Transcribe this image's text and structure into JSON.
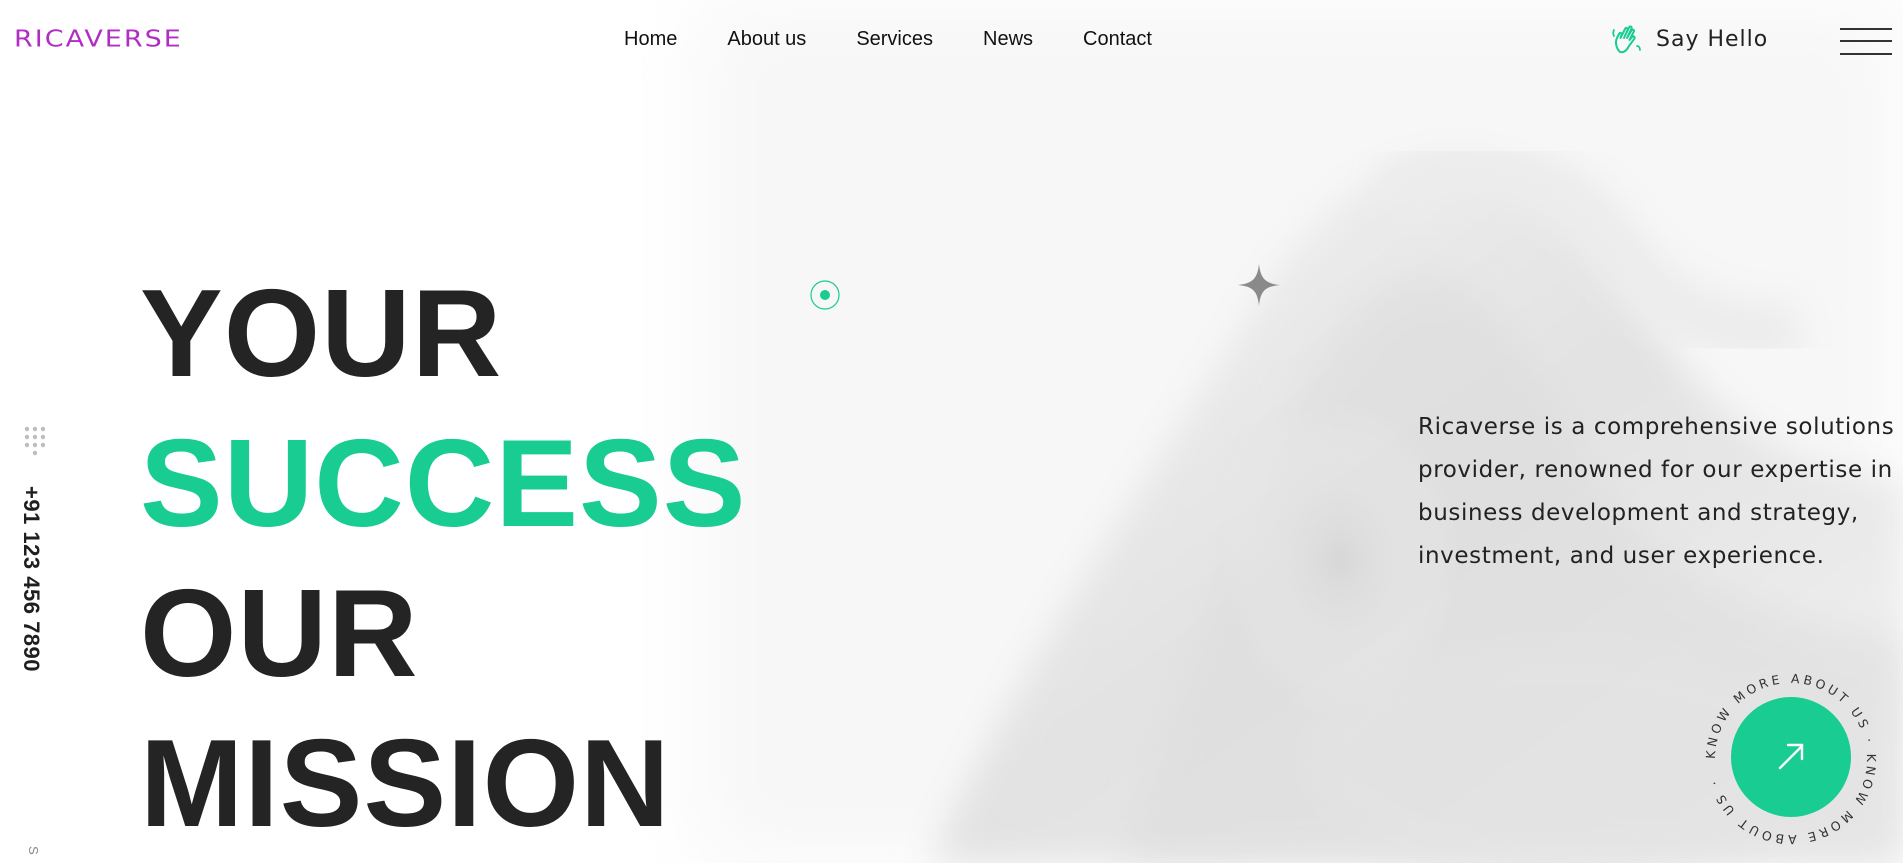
{
  "header": {
    "logo_text": "RICAVERSE",
    "nav": [
      "Home",
      "About us",
      "Services",
      "News",
      "Contact"
    ],
    "say_hello_label": "Say Hello",
    "say_hello_icon": "waving-hand-icon",
    "menu_icon": "hamburger-menu-icon"
  },
  "side": {
    "dial_icon": "dialpad-icon",
    "phone": "+91 123 456 7890",
    "partial_text": "S"
  },
  "hero": {
    "line1": "YOUR",
    "line2": "SUCCESS",
    "line3": "OUR",
    "line4": "MISSION"
  },
  "description": "Ricaverse is a comprehensive solutions provider, renowned for our expertise in business development and strategy, investment, and user experience.",
  "cta": {
    "circular_text": "KNOW MORE ABOUT US · KNOW MORE ABOUT US · ",
    "icon": "arrow-up-right-icon"
  },
  "colors": {
    "accent": "#18cc92",
    "logo": "#b02ec4",
    "text_dark": "#242424"
  }
}
